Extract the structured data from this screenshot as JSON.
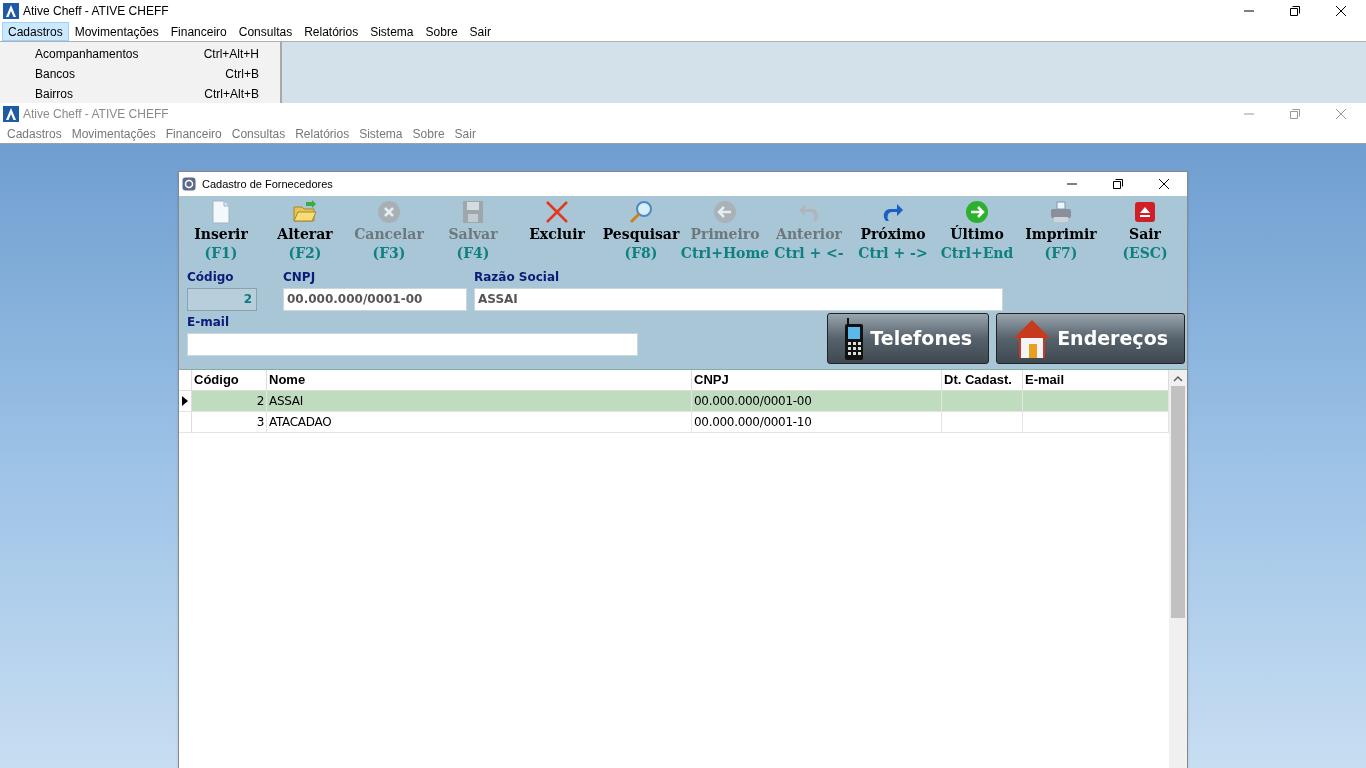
{
  "app_window": {
    "title": "Ative Cheff - ATIVE CHEFF",
    "menu": [
      {
        "label": "Cadastros",
        "selected": true
      },
      {
        "label": "Movimentações",
        "selected": false
      },
      {
        "label": "Financeiro",
        "selected": false
      },
      {
        "label": "Consultas",
        "selected": false
      },
      {
        "label": "Relatórios",
        "selected": false
      },
      {
        "label": "Sistema",
        "selected": false
      },
      {
        "label": "Sobre",
        "selected": false
      },
      {
        "label": "Sair",
        "selected": false
      }
    ],
    "dropdown": [
      {
        "label": "Acompanhamentos",
        "shortcut": "Ctrl+Alt+H"
      },
      {
        "label": "Bancos",
        "shortcut": "Ctrl+B"
      },
      {
        "label": "Bairros",
        "shortcut": "Ctrl+Alt+B"
      }
    ]
  },
  "child_window": {
    "title": "Ative Cheff - ATIVE CHEFF",
    "menu": [
      "Cadastros",
      "Movimentações",
      "Financeiro",
      "Consultas",
      "Relatórios",
      "Sistema",
      "Sobre",
      "Sair"
    ]
  },
  "dialog": {
    "title": "Cadastro de Fornecedores",
    "toolbar": [
      {
        "kind": "insert",
        "label": "Inserir",
        "shortcut": "(F1)",
        "disabled": false
      },
      {
        "kind": "edit",
        "label": "Alterar",
        "shortcut": "(F2)",
        "disabled": false
      },
      {
        "kind": "cancel",
        "label": "Cancelar",
        "shortcut": "(F3)",
        "disabled": true
      },
      {
        "kind": "save",
        "label": "Salvar",
        "shortcut": "(F4)",
        "disabled": true
      },
      {
        "kind": "delete",
        "label": "Excluir",
        "disabled": false
      },
      {
        "kind": "search",
        "label": "Pesquisar",
        "shortcut": "(F8)",
        "disabled": false
      },
      {
        "kind": "first",
        "label": "Primeiro",
        "shortcut": "Ctrl+Home",
        "disabled": true
      },
      {
        "kind": "previous",
        "label": "Anterior",
        "shortcut": "Ctrl + <-",
        "disabled": true
      },
      {
        "kind": "next",
        "label": "Próximo",
        "shortcut": "Ctrl + ->",
        "disabled": false
      },
      {
        "kind": "last",
        "label": "Último",
        "shortcut": "Ctrl+End",
        "disabled": false
      },
      {
        "kind": "print",
        "label": "Imprimir",
        "shortcut": "(F7)",
        "disabled": false
      },
      {
        "kind": "exit",
        "label": "Sair",
        "shortcut": "(ESC)",
        "disabled": false
      }
    ],
    "fields": {
      "codigo": {
        "label": "Código",
        "value": "2"
      },
      "cnpj": {
        "label": "CNPJ",
        "value": "00.000.000/0001-00"
      },
      "razao_social": {
        "label": "Razão Social",
        "value": "ASSAI"
      },
      "email": {
        "label": "E-mail"
      }
    },
    "buttons": [
      {
        "kind": "phone",
        "label": "Telefones"
      },
      {
        "kind": "home",
        "label": "Endereços"
      }
    ],
    "table": {
      "columns": [
        "Código",
        "Nome",
        "CNPJ",
        "Dt. Cadast.",
        "E-mail"
      ],
      "rows": [
        {
          "selected": true,
          "cells": [
            "2",
            "ASSAI",
            "00.000.000/0001-00",
            "",
            ""
          ]
        },
        {
          "selected": false,
          "cells": [
            "3",
            "ATACADAO",
            "00.000.000/0001-10",
            "",
            ""
          ]
        }
      ]
    }
  }
}
